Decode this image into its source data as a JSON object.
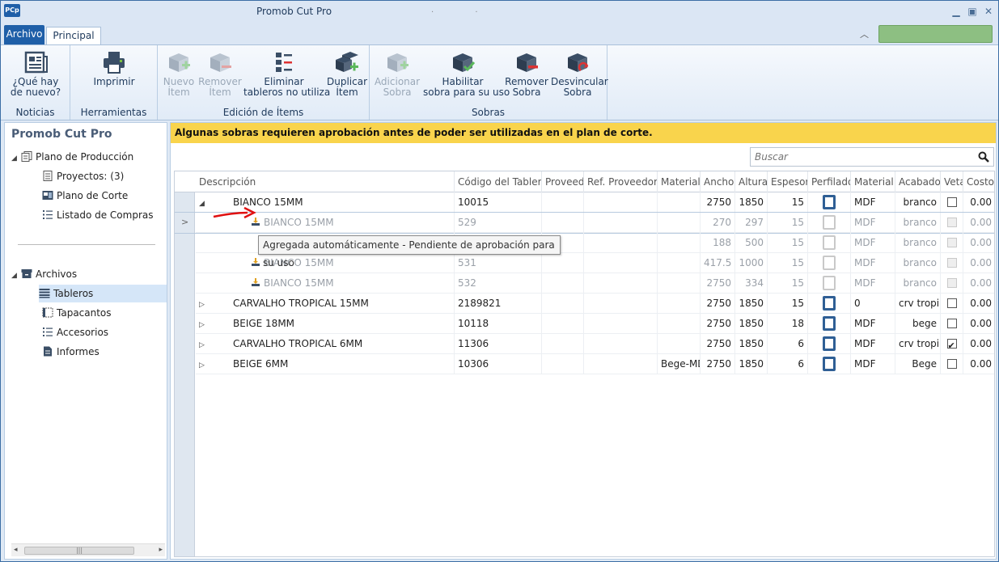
{
  "titlebar": {
    "app_icon": "PCp",
    "title": "Promob Cut Pro",
    "title_dots": ". .",
    "minimize_icon": "minimize-icon",
    "restore_icon": "restore-icon",
    "close_icon": "close-icon"
  },
  "ribbon_tabs": {
    "archivo": "Archivo",
    "principal": "Principal"
  },
  "ribbon": {
    "noticias": {
      "label": "Noticias",
      "whats_new": "¿Qué hay\nde nuevo?"
    },
    "herramientas": {
      "label": "Herramientas",
      "imprimir": "Imprimir"
    },
    "edicion": {
      "label": "Edición de Ítems",
      "nuevo": "Nuevo\nÍtem",
      "remover": "Remover\nÍtem",
      "eliminar": "Eliminar\ntableros no utiliza",
      "duplicar": "Duplicar\nÍtem"
    },
    "sobras": {
      "label": "Sobras",
      "adicionar": "Adicionar\nSobra",
      "habilitar": "Habilitar\nsobra para su uso",
      "remover": "Remover\nSobra",
      "desvincular": "Desvincular\nSobra"
    }
  },
  "sidebar": {
    "title": "Promob Cut Pro",
    "plano_produccion": "Plano de Producción",
    "proyectos": "Proyectos: (3)",
    "plano_corte": "Plano de Corte",
    "listado_compras": "Listado de Compras",
    "archivos": "Archivos",
    "tableros": "Tableros",
    "tapacantos": "Tapacantos",
    "accesorios": "Accesorios",
    "informes": "Informes",
    "scroll_thumb": "|||"
  },
  "main": {
    "warning": "Algunas sobras requieren aprobación antes de poder ser utilizadas en el plan de corte.",
    "search_placeholder": "Buscar",
    "tooltip": "Agregada automáticamente - Pendiente de aprobación para su uso",
    "current_row_marker": ">"
  },
  "grid": {
    "columns": [
      "Descripción",
      "Código del Tablero",
      "Proveedor",
      "Ref. Proveedor",
      "Material",
      "Ancho",
      "Altura",
      "Espesor",
      "Perfilado",
      "Material",
      "Acabado",
      "Veta",
      "Costo"
    ],
    "rows": [
      {
        "expander": "◢",
        "desc": "BIANCO 15MM",
        "codigo": "10015",
        "proveedor": "",
        "ref": "",
        "material": "",
        "ancho": "2750",
        "altura": "1850",
        "espesor": "15",
        "material2": "MDF",
        "acabado": "branco",
        "veta": false,
        "costo": "0.00"
      },
      {
        "expander": "",
        "desc": "BIANCO 15MM",
        "codigo": "529",
        "proveedor": "",
        "ref": "",
        "material": "",
        "ancho": "270",
        "altura": "297",
        "espesor": "15",
        "material2": "MDF",
        "acabado": "branco",
        "veta": false,
        "costo": "0.00"
      },
      {
        "expander": "",
        "desc": "",
        "codigo": "",
        "proveedor": "",
        "ref": "",
        "material": "",
        "ancho": "188",
        "altura": "500",
        "espesor": "15",
        "material2": "MDF",
        "acabado": "branco",
        "veta": false,
        "costo": "0.00"
      },
      {
        "expander": "",
        "desc": "BIANCO 15MM",
        "codigo": "531",
        "proveedor": "",
        "ref": "",
        "material": "",
        "ancho": "417.5",
        "altura": "1000",
        "espesor": "15",
        "material2": "MDF",
        "acabado": "branco",
        "veta": false,
        "costo": "0.00"
      },
      {
        "expander": "",
        "desc": "BIANCO 15MM",
        "codigo": "532",
        "proveedor": "",
        "ref": "",
        "material": "",
        "ancho": "2750",
        "altura": "334",
        "espesor": "15",
        "material2": "MDF",
        "acabado": "branco",
        "veta": false,
        "costo": "0.00"
      },
      {
        "expander": "▷",
        "desc": "CARVALHO TROPICAL 15MM",
        "codigo": "2189821",
        "proveedor": "",
        "ref": "",
        "material": "",
        "ancho": "2750",
        "altura": "1850",
        "espesor": "15",
        "material2": "0",
        "acabado": "crv tropi",
        "veta": false,
        "costo": "0.00"
      },
      {
        "expander": "▷",
        "desc": "BEIGE 18MM",
        "codigo": "10118",
        "proveedor": "",
        "ref": "",
        "material": "",
        "ancho": "2750",
        "altura": "1850",
        "espesor": "18",
        "material2": "MDF",
        "acabado": "bege",
        "veta": false,
        "costo": "0.00"
      },
      {
        "expander": "▷",
        "desc": "CARVALHO TROPICAL 6MM",
        "codigo": "11306",
        "proveedor": "",
        "ref": "",
        "material": "",
        "ancho": "2750",
        "altura": "1850",
        "espesor": "6",
        "material2": "MDF",
        "acabado": "crv tropi",
        "veta": true,
        "costo": "0.00"
      },
      {
        "expander": "▷",
        "desc": "BEIGE 6MM",
        "codigo": "10306",
        "proveedor": "",
        "ref": "",
        "material": "Bege-MD",
        "ancho": "2750",
        "altura": "1850",
        "espesor": "6",
        "material2": "MDF",
        "acabado": "Bege",
        "veta": false,
        "costo": "0.00"
      }
    ]
  },
  "colors": {
    "accent": "#1f5fa8",
    "warning": "#f9d44c",
    "green_panel": "#8dbf82",
    "arrow": "#e01010"
  }
}
